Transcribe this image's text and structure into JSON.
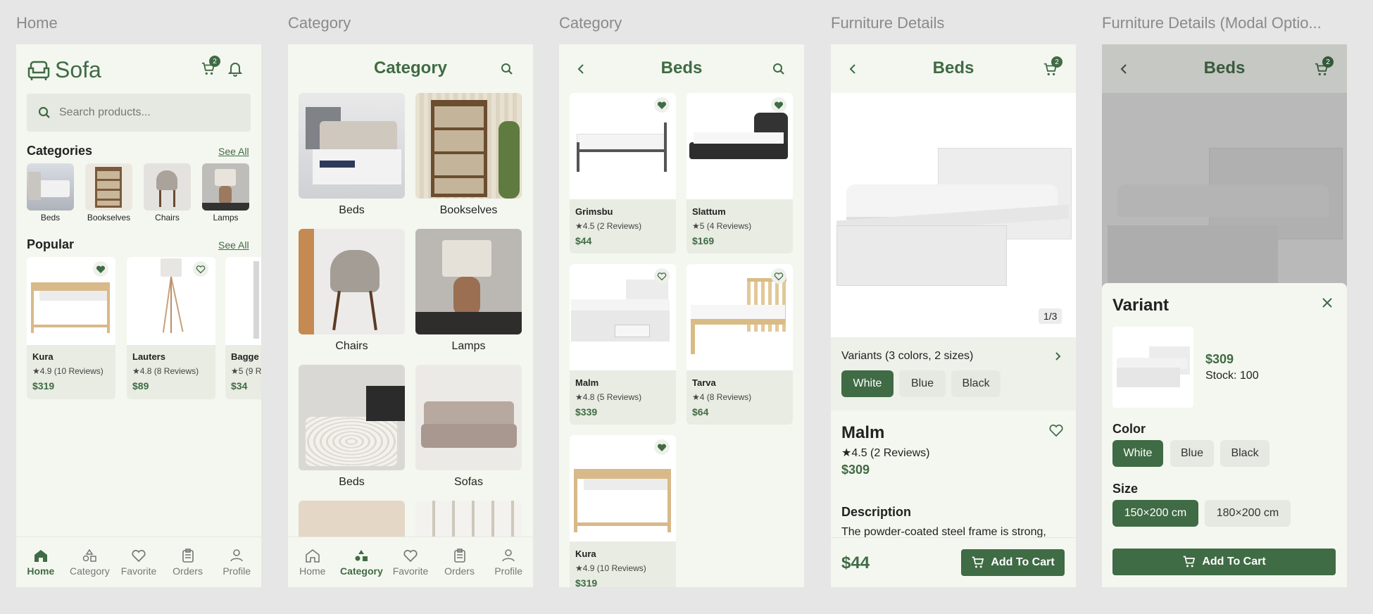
{
  "frames": {
    "f1": "Home",
    "f2": "Category",
    "f3": "Category",
    "f4": "Furniture Details",
    "f5": "Furniture Details (Modal Optio..."
  },
  "home": {
    "logo": "Sofa",
    "cart_count": "2",
    "search_placeholder": "Search products...",
    "categories_title": "Categories",
    "see_all": "See All",
    "categories": [
      "Beds",
      "Bookselves",
      "Chairs",
      "Lamps"
    ],
    "popular_title": "Popular",
    "popular": [
      {
        "name": "Kura",
        "reviews": "4.9 (10 Reviews)",
        "price": "$319"
      },
      {
        "name": "Lauters",
        "reviews": "4.8 (8 Reviews)",
        "price": "$89"
      },
      {
        "name": "Bagge",
        "reviews": "5 (9 R",
        "price": "$34"
      }
    ]
  },
  "nav": {
    "home": "Home",
    "category": "Category",
    "favorite": "Favorite",
    "orders": "Orders",
    "profile": "Profile"
  },
  "category": {
    "title": "Category",
    "items": [
      "Beds",
      "Bookselves",
      "Chairs",
      "Lamps",
      "Beds",
      "Sofas"
    ]
  },
  "beds": {
    "title": "Beds",
    "products": [
      {
        "name": "Grimsbu",
        "reviews": "4.5 (2 Reviews)",
        "price": "$44"
      },
      {
        "name": "Slattum",
        "reviews": "5 (4 Reviews)",
        "price": "$169"
      },
      {
        "name": "Malm",
        "reviews": "4.8 (5 Reviews)",
        "price": "$339"
      },
      {
        "name": "Tarva",
        "reviews": "4 (8 Reviews)",
        "price": "$64"
      },
      {
        "name": "Kura",
        "reviews": "4.9 (10 Reviews)",
        "price": "$319"
      }
    ]
  },
  "details": {
    "title": "Beds",
    "cart_count": "2",
    "image_counter": "1/3",
    "variants_label": "Variants (3 colors, 2 sizes)",
    "colors": [
      "White",
      "Blue",
      "Black"
    ],
    "name": "Malm",
    "reviews": "4.5 (2 Reviews)",
    "price": "$309",
    "description_title": "Description",
    "description": "The powder-coated steel frame is strong,",
    "footer_price": "$44",
    "add_to_cart": "Add To Cart"
  },
  "modal": {
    "title": "Beds",
    "cart_count": "2",
    "variant_title": "Variant",
    "price": "$309",
    "stock": "Stock: 100",
    "color_label": "Color",
    "colors": [
      "White",
      "Blue",
      "Black"
    ],
    "size_label": "Size",
    "sizes": [
      "150×200 cm",
      "180×200 cm"
    ],
    "add_to_cart": "Add To Cart"
  },
  "colors": {
    "accent": "#3f6b45",
    "background": "#f4f7ef",
    "card": "#e8ece2"
  }
}
